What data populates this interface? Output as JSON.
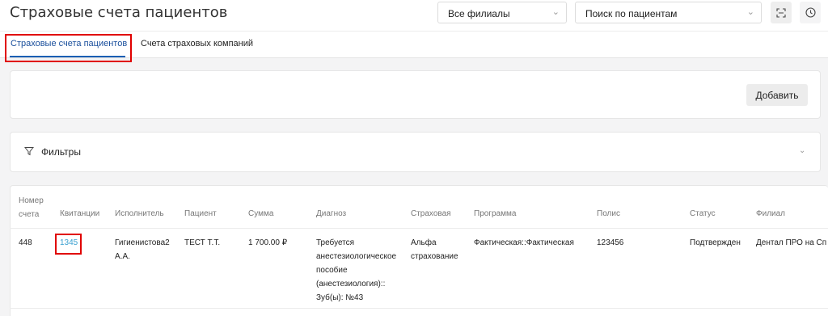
{
  "header": {
    "title": "Страховые счета пациентов",
    "branch_select": "Все филиалы",
    "patient_search": "Поиск по пациентам",
    "scan_icon": "scan-icon",
    "clock_icon": "clock-icon"
  },
  "tabs": [
    {
      "label": "Страховые счета пациентов",
      "active": true
    },
    {
      "label": "Счета страховых компаний",
      "active": false
    }
  ],
  "actions": {
    "add_label": "Добавить"
  },
  "filters": {
    "label": "Фильтры"
  },
  "table": {
    "columns": [
      "Номер счета",
      "Квитанции",
      "Исполнитель",
      "Пациент",
      "Сумма",
      "Диагноз",
      "Страховая",
      "Программа",
      "Полис",
      "Статус",
      "Филиал"
    ],
    "rows": [
      {
        "number": "448",
        "receipt": "1345",
        "performer": "Гигиенистова2 А.А.",
        "patient": "ТЕСТ Т.Т.",
        "amount": "1 700.00 ₽",
        "diagnosis": "Требуется анестезиологическое пособие (анестезиология):: Зуб(ы): №43",
        "insurer": "Альфа страхование",
        "program": "Фактическая::Фактическая",
        "policy": "123456",
        "status": "Подтвержден",
        "branch": "Дентал ПРО на Сп"
      }
    ]
  },
  "colors": {
    "accent": "#1a5fb4",
    "link": "#3aa0d0",
    "highlight": "#e00000"
  }
}
